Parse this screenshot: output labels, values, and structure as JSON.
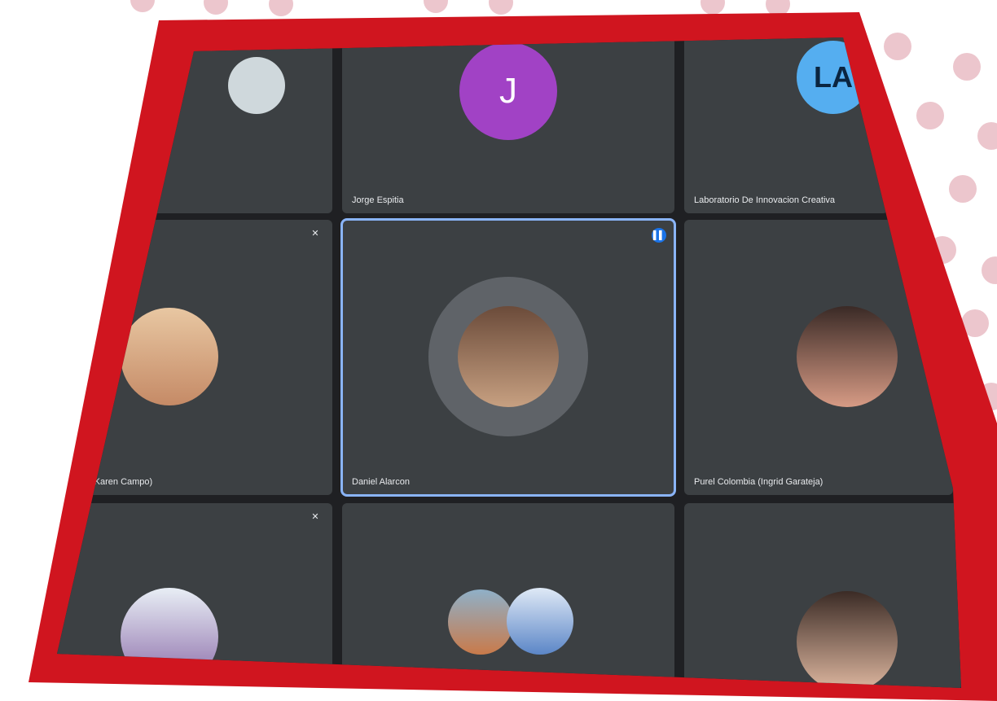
{
  "meeting": {
    "participants": [
      {
        "id": "p1",
        "name": "",
        "muted": false
      },
      {
        "id": "p2",
        "name": "Jorge Espitia",
        "initial": "J",
        "avatar_color": "#a142c5",
        "muted": false
      },
      {
        "id": "p3",
        "name": "Laboratorio De Innovacion Creativa",
        "logo_text": "LA",
        "muted": false
      },
      {
        "id": "p4",
        "name": "(Karen Campo)",
        "muted": true
      },
      {
        "id": "p5",
        "name": "Daniel Alarcon",
        "speaking": true
      },
      {
        "id": "p6",
        "name": "Purel Colombia (Ingrid Garateja)",
        "muted": false
      },
      {
        "id": "p7",
        "name": "",
        "muted": true
      },
      {
        "id": "p8",
        "name": "",
        "muted": false
      },
      {
        "id": "p9",
        "name": "",
        "muted": false
      }
    ]
  },
  "colors": {
    "frame": "#d0151f",
    "tile": "#3c4043",
    "active_border": "#8ab4f8",
    "speaking_badge": "#1a73e8"
  }
}
